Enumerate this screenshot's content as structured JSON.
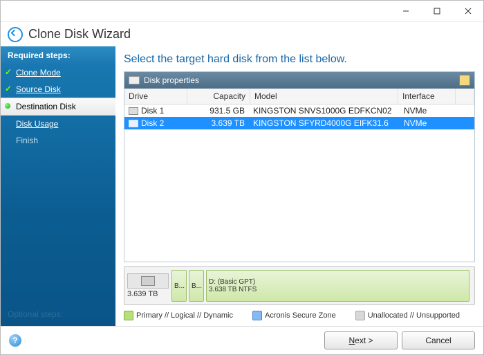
{
  "window": {
    "title": "Clone Disk Wizard"
  },
  "sidebar": {
    "heading": "Required steps:",
    "steps": [
      {
        "label": "Clone Mode",
        "state": "done"
      },
      {
        "label": "Source Disk",
        "state": "done"
      },
      {
        "label": "Destination Disk",
        "state": "active"
      },
      {
        "label": "Disk Usage",
        "state": "pending"
      },
      {
        "label": "Finish",
        "state": "future"
      }
    ],
    "optional_label": "Optional steps:"
  },
  "main": {
    "prompt": "Select the target hard disk from the list below.",
    "panel_title": "Disk properties",
    "columns": {
      "drive": "Drive",
      "capacity": "Capacity",
      "model": "Model",
      "interface": "Interface"
    },
    "disks": [
      {
        "drive": "Disk 1",
        "capacity": "931.5 GB",
        "model": "KINGSTON SNVS1000G EDFKCN02",
        "interface": "NVMe",
        "selected": false
      },
      {
        "drive": "Disk 2",
        "capacity": "3.639 TB",
        "model": "KINGSTON SFYRD4000G EIFK31.6",
        "interface": "NVMe",
        "selected": true
      }
    ],
    "diskmap": {
      "total": "3.639 TB",
      "partitions": [
        {
          "label_top": "B...",
          "label_bot": "",
          "size": "small"
        },
        {
          "label_top": "B...",
          "label_bot": "",
          "size": "small"
        },
        {
          "label_top": "D: (Basic GPT)",
          "label_bot": "3.638 TB  NTFS",
          "size": "big"
        }
      ]
    },
    "legend": {
      "primary": "Primary // Logical // Dynamic",
      "secure": "Acronis Secure Zone",
      "unalloc": "Unallocated // Unsupported"
    }
  },
  "footer": {
    "next": "Next >",
    "cancel": "Cancel"
  }
}
